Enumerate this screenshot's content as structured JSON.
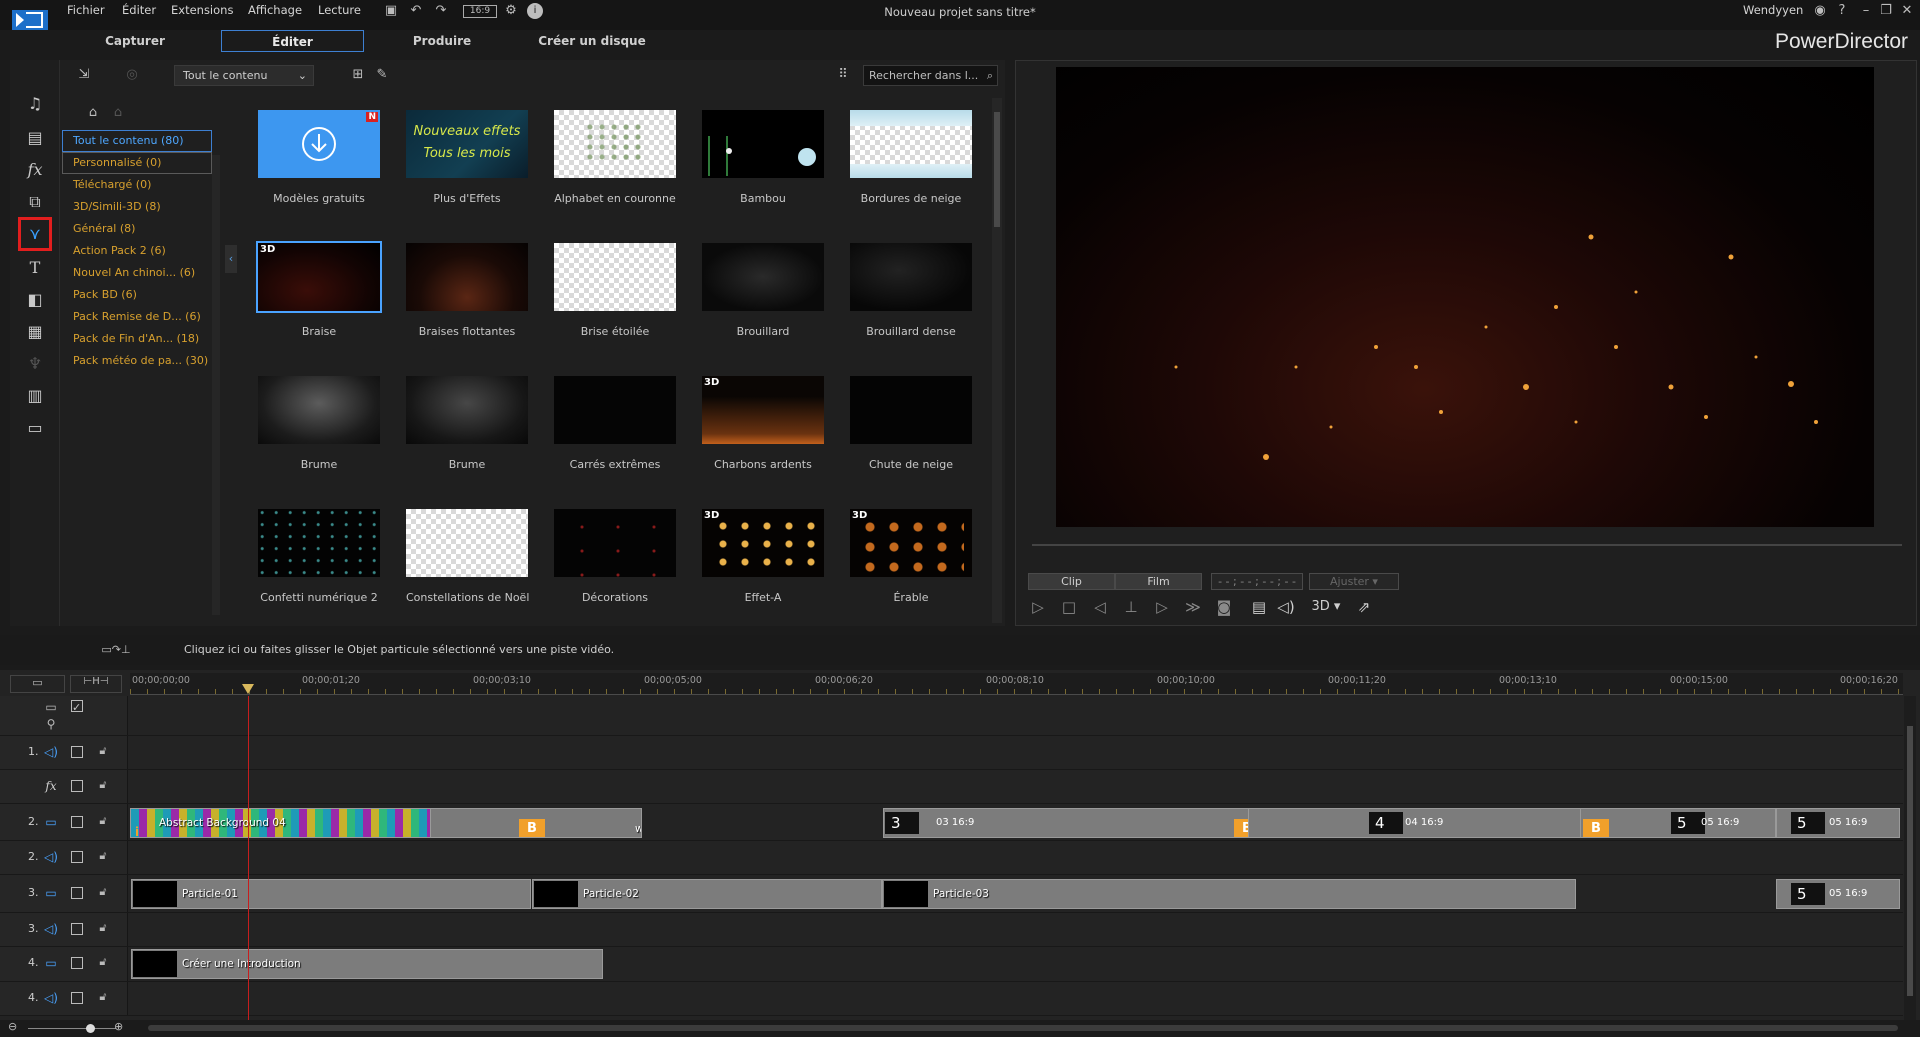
{
  "app": {
    "menu": [
      "Fichier",
      "Éditer",
      "Extensions",
      "Affichage",
      "Lecture"
    ],
    "doc_title": "Nouveau projet sans titre*",
    "user": "Wendyyen",
    "brand": "PowerDirector",
    "aspect": "16:9"
  },
  "modes": {
    "capture": "Capturer",
    "edit": "Éditer",
    "produce": "Produire",
    "create_disc": "Créer un disque"
  },
  "library": {
    "filter": "Tout le contenu",
    "search_placeholder": "Rechercher dans l...",
    "categories": [
      {
        "label": "Tout le contenu (80)"
      },
      {
        "label": "Personnalisé  (0)"
      },
      {
        "label": "Téléchargé  (0)"
      },
      {
        "label": "3D/Simili-3D  (8)"
      },
      {
        "label": "Général  (8)"
      },
      {
        "label": "Action Pack 2  (6)"
      },
      {
        "label": "Nouvel An chinoi...  (6)"
      },
      {
        "label": "Pack BD  (6)"
      },
      {
        "label": "Pack Remise de D...  (6)"
      },
      {
        "label": "Pack de Fin d'An...  (18)"
      },
      {
        "label": "Pack météo de pa...  (30)"
      }
    ],
    "items": [
      {
        "label": "Modèles gratuits",
        "badge": "N"
      },
      {
        "label": "Plus d'Effets",
        "line1": "Nouveaux effets",
        "line2": "Tous les mois"
      },
      {
        "label": "Alphabet en couronne"
      },
      {
        "label": "Bambou"
      },
      {
        "label": "Bordures de neige"
      },
      {
        "label": "Braise",
        "badge": "3D"
      },
      {
        "label": "Braises flottantes"
      },
      {
        "label": "Brise étoilée"
      },
      {
        "label": "Brouillard"
      },
      {
        "label": "Brouillard dense"
      },
      {
        "label": "Brume"
      },
      {
        "label": "Brume"
      },
      {
        "label": "Carrés extrêmes"
      },
      {
        "label": "Charbons ardents",
        "badge": "3D"
      },
      {
        "label": "Chute de neige"
      },
      {
        "label": "Confetti numérique 2"
      },
      {
        "label": "Constellations de Noël"
      },
      {
        "label": "Décorations"
      },
      {
        "label": "Effet-A",
        "badge": "3D"
      },
      {
        "label": "Érable",
        "badge": "3D"
      }
    ]
  },
  "preview": {
    "clip": "Clip",
    "film": "Film",
    "timecode": "- - ; - - ; - - ; - -",
    "fit": "Ajuster",
    "mode_3d": "3D"
  },
  "hint": "Cliquez ici ou faites glisser le Objet particule sélectionné vers une piste vidéo.",
  "timeline": {
    "ticks": [
      "00;00;00;00",
      "00;00;01;20",
      "00;00;03;10",
      "00;00;05;00",
      "00;00;06;20",
      "00;00;08;10",
      "00;00;10;00",
      "00;00;11;20",
      "00;00;13;10",
      "00;00;15;00",
      "00;00;16;20"
    ],
    "tracks": [
      "1.",
      "fx",
      "2.",
      "2.",
      "3.",
      "3.",
      "4.",
      "4."
    ],
    "clips": {
      "abstract": "Abstract Background 04",
      "w": "w",
      "p1": "Particle-01",
      "p2": "Particle-02",
      "p3": "Particle-03",
      "intro": "Créer une Introduction",
      "t3": "3",
      "t3_meta": "03 16:9",
      "t4": "4",
      "t4_meta": "04 16:9",
      "t5": "5",
      "t5_meta": "05 16:9",
      "b": "B"
    }
  },
  "colors": {
    "accent": "#3d7fd1",
    "category": "#d7a02e",
    "highlight_box": "#e21e1e",
    "playhead": "#c61e1e",
    "bookmark": "#f1a02b"
  }
}
